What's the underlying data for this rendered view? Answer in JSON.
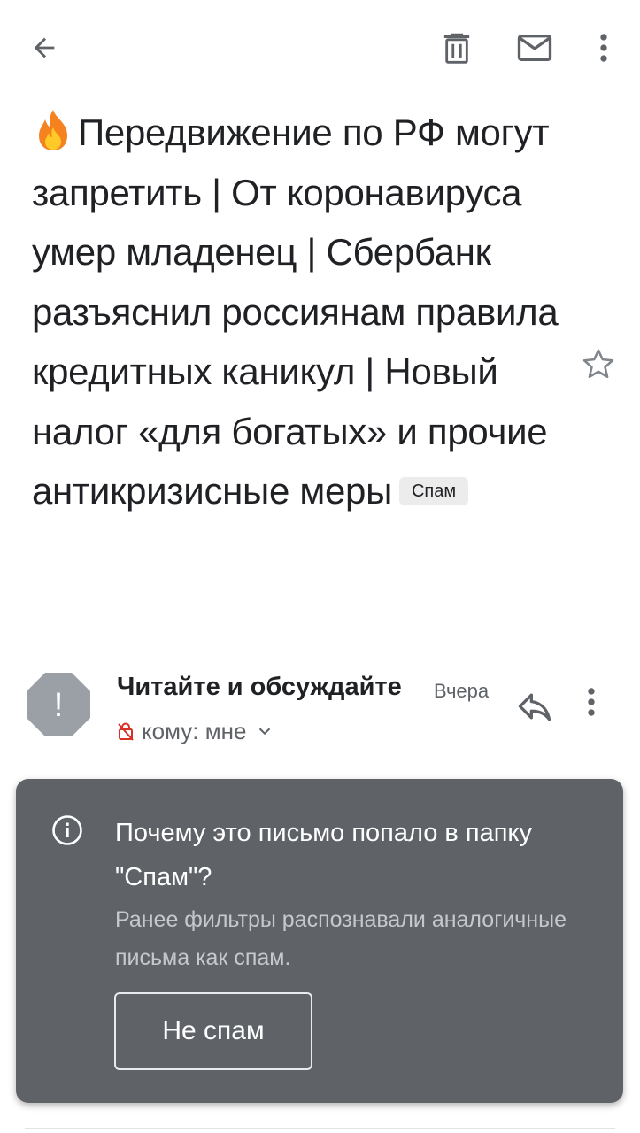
{
  "toolbar": {
    "back_icon": "arrow-left-icon",
    "delete_icon": "trash-icon",
    "mark_unread_icon": "mail-icon",
    "more_icon": "more-vert-icon"
  },
  "email": {
    "subject_emoji": "fire-icon",
    "subject": "Передвижение по РФ могут запретить | От коронавируса умер младенец | Сбербанк разъяснил россиянам правила кредитных каникул |  Новый налог «для богатых» и прочие антикризисные меры",
    "label": "Спам",
    "starred": false
  },
  "sender": {
    "avatar_icon": "warning-octagon-icon",
    "avatar_text": "!",
    "name": "Читайте и обсуждайте",
    "time": "Вчера",
    "recipient": "кому: мне"
  },
  "spam_banner": {
    "title": "Почему это письмо попало в папку \"Спам\"?",
    "body": "Ранее фильтры распознавали аналогичные письма как спам.",
    "button_label": "Не спам"
  },
  "colors": {
    "card_bg": "#5f6368",
    "text_primary": "#202124",
    "text_secondary": "#5f6368",
    "warning_avatar": "#9aa0a6",
    "lock_red": "#d93025",
    "fire_orange": "#f5811f"
  }
}
